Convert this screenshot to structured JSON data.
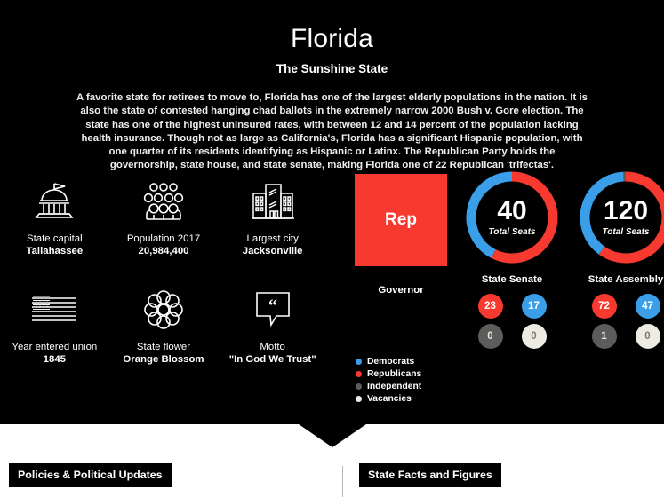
{
  "header": {
    "state_name": "Florida",
    "nickname": "The Sunshine State",
    "description": "A favorite state for retirees to move to, Florida has one of the largest elderly populations in the nation. It is also the state of contested hanging chad ballots in the extremely narrow 2000 Bush v. Gore election. The state has one of the highest uninsured rates, with between 12 and 14 percent of the population lacking health insurance. Though not as large as California's, Florida has a significant Hispanic population, with one quarter of its residents identifying as Hispanic or Latinx. The Republican Party holds the governorship, state house, and state senate, making Florida one of 22 Republican 'trifectas'."
  },
  "facts": [
    {
      "icon": "capitol-building-icon",
      "label": "State capital",
      "value": "Tallahassee"
    },
    {
      "icon": "people-group-icon",
      "label": "Population 2017",
      "value": "20,984,400"
    },
    {
      "icon": "city-buildings-icon",
      "label": "Largest city",
      "value": "Jacksonville"
    },
    {
      "icon": "usa-flag-icon",
      "label": "Year entered union",
      "value": "1845"
    },
    {
      "icon": "flower-icon",
      "label": "State flower",
      "value": "Orange Blossom"
    },
    {
      "icon": "quote-bubble-icon",
      "label": "Motto",
      "value": "\"In God We Trust\""
    }
  ],
  "politics": {
    "governor": {
      "party_abbr": "Rep",
      "caption": "Governor",
      "color": "#f7392f"
    },
    "chambers": [
      {
        "caption": "State Senate",
        "total": "40",
        "total_sub": "Total Seats",
        "seats": {
          "republicans": 23,
          "democrats": 17,
          "independent": 0,
          "vacancies": 0
        },
        "badges": [
          {
            "key": "republicans",
            "value": "23",
            "color": "#f7392f",
            "text_color": "#ffffff"
          },
          {
            "key": "democrats",
            "value": "17",
            "color": "#3a9fe8",
            "text_color": "#ffffff"
          },
          {
            "key": "independent",
            "value": "0",
            "color": "#5c5c5c",
            "text_color": "#f0e9d2"
          },
          {
            "key": "vacancies",
            "value": "0",
            "color": "#ecece4",
            "text_color": "#7a7a66"
          }
        ]
      },
      {
        "caption": "State Assembly",
        "total": "120",
        "total_sub": "Total Seats",
        "seats": {
          "republicans": 72,
          "democrats": 47,
          "independent": 1,
          "vacancies": 0
        },
        "badges": [
          {
            "key": "republicans",
            "value": "72",
            "color": "#f7392f",
            "text_color": "#ffffff"
          },
          {
            "key": "democrats",
            "value": "47",
            "color": "#3a9fe8",
            "text_color": "#ffffff"
          },
          {
            "key": "independent",
            "value": "1",
            "color": "#5c5c5c",
            "text_color": "#f0e9d2"
          },
          {
            "key": "vacancies",
            "value": "0",
            "color": "#ecece4",
            "text_color": "#7a7a66"
          }
        ]
      }
    ],
    "legend": [
      {
        "label": "Democrats",
        "color": "#3a9fe8"
      },
      {
        "label": "Republicans",
        "color": "#f7392f"
      },
      {
        "label": "Independent",
        "color": "#5c5c5c"
      },
      {
        "label": "Vacancies",
        "color": "#ecece4"
      }
    ]
  },
  "bottom": {
    "left_tag": "Policies & Political Updates",
    "right_tag": "State Facts and Figures"
  },
  "chart_data": [
    {
      "type": "pie",
      "title": "State Senate",
      "center_label": "40",
      "center_sublabel": "Total Seats",
      "categories": [
        "Republicans",
        "Democrats",
        "Independent",
        "Vacancies"
      ],
      "values": [
        23,
        17,
        0,
        0
      ],
      "colors": [
        "#f7392f",
        "#3a9fe8",
        "#5c5c5c",
        "#ecece4"
      ],
      "total": 40,
      "legend_position": "below-left",
      "donut": true
    },
    {
      "type": "pie",
      "title": "State Assembly",
      "center_label": "120",
      "center_sublabel": "Total Seats",
      "categories": [
        "Republicans",
        "Democrats",
        "Independent",
        "Vacancies"
      ],
      "values": [
        72,
        47,
        1,
        0
      ],
      "colors": [
        "#f7392f",
        "#3a9fe8",
        "#5c5c5c",
        "#ecece4"
      ],
      "total": 120,
      "legend_position": "below-left",
      "donut": true
    }
  ]
}
